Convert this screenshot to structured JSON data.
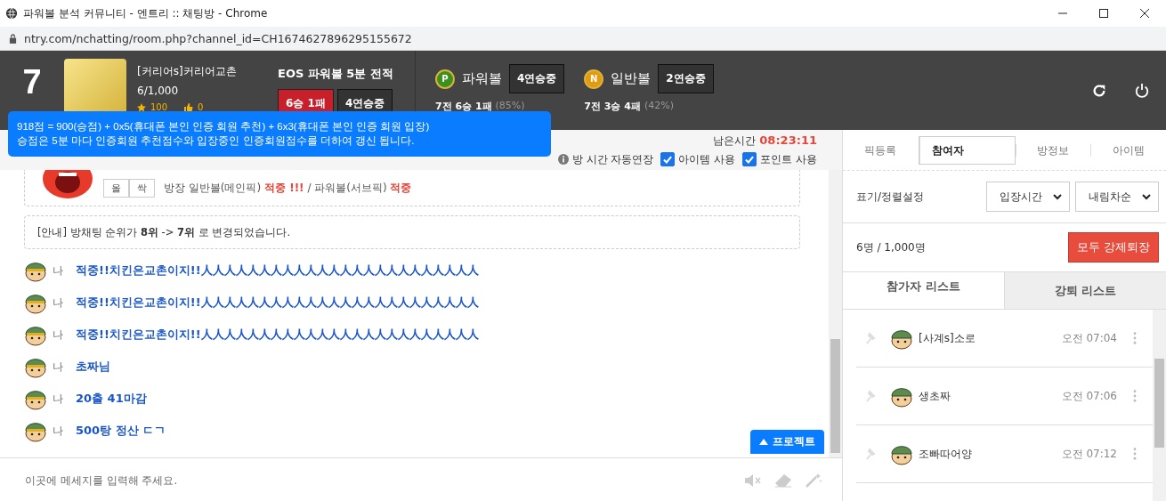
{
  "browser": {
    "title": "파워볼 분석 커뮤니티 - 엔트리 :: 채팅방 - Chrome",
    "url": "ntry.com/nchatting/room.php?channel_id=CH1674627896295155672"
  },
  "header": {
    "rank": "7",
    "room": {
      "name": "[커리어s]커리어교촌",
      "members": "6/1,000",
      "stars": "100",
      "likes": "0"
    },
    "eos": {
      "title": "EOS 파워볼 5분 전적",
      "record": "6승 1패",
      "streak": "4연승중"
    },
    "games": [
      {
        "kind": "powerball",
        "badge": "P",
        "name": "파워볼",
        "streak": "4연승중",
        "record": "7전 6승 1패",
        "rate": "(85%)"
      },
      {
        "kind": "normal",
        "badge": "N",
        "name": "일반볼",
        "streak": "2연승중",
        "record": "7전 3승 4패",
        "rate": "(42%)"
      }
    ]
  },
  "tooltip": {
    "lines": [
      "918점 = 900(승점) + 0x5(휴대폰 본인 인증 회원 추천) + 6x3(휴대폰 본인 인증 회원 입장)",
      "승점은 5분 마다 인증회원 추천점수와 입장중인 인증회원점수를 더하여 갱신 됩니다."
    ]
  },
  "room_bar": {
    "remaining_label": "남은시간",
    "remaining": "08:23:11",
    "options": [
      {
        "kind": "info",
        "label": "방 시간 자동연장"
      },
      {
        "kind": "checkbox",
        "label": "아이템 사용",
        "checked": true
      },
      {
        "kind": "checkbox",
        "label": "포인트 사용",
        "checked": true
      }
    ]
  },
  "chat": {
    "pick": {
      "buttons": [
        "올",
        "싹"
      ],
      "segments": [
        {
          "text": "방장 일반볼(메인픽) ",
          "hit": false
        },
        {
          "text": "적중 !!!",
          "hit": true
        },
        {
          "text": " / 파워볼(서브픽) ",
          "hit": false
        },
        {
          "text": "적중",
          "hit": true
        }
      ]
    },
    "notice": "[안내] 방채팅 순위가 **8위** -> **7위** 로 변경되었습니다.",
    "messages": [
      {
        "sender": "나",
        "text": "적중!!치킨은교촌이지!!人人人人人人人人人人人人人人人人人人人人人人人人"
      },
      {
        "sender": "나",
        "text": "적중!!치킨은교촌이지!!人人人人人人人人人人人人人人人人人人人人人人人人"
      },
      {
        "sender": "나",
        "text": "적중!!치킨은교촌이지!!人人人人人人人人人人人人人人人人人人人人人人人人"
      },
      {
        "sender": "나",
        "text": "초짜님"
      },
      {
        "sender": "나",
        "text": "20출 41마감"
      },
      {
        "sender": "나",
        "text": "500탕 정산 ㄷㄱ"
      }
    ],
    "project_button": "프로젝트",
    "input": {
      "placeholder": "이곳에 메세지를 입력해 주세요."
    }
  },
  "panel": {
    "tabs": [
      {
        "label": "픽등록",
        "selected": false
      },
      {
        "label": "참여자",
        "selected": true
      },
      {
        "label": "방정보",
        "selected": false
      },
      {
        "label": "아이템",
        "selected": false
      }
    ],
    "sort_label": "표기/정렬설정",
    "sort_field": "입장시간",
    "sort_order": "내림차순",
    "count": "6명 / 1,000명",
    "kick_all": "모두 강제퇴장",
    "list_tabs": [
      {
        "label": "참가자 리스트",
        "selected": true
      },
      {
        "label": "강퇴 리스트",
        "selected": false
      }
    ],
    "participants": [
      {
        "name": "[사계s]소로",
        "time": "오전 07:04"
      },
      {
        "name": "생초짜",
        "time": "오전 07:06"
      },
      {
        "name": "조빠따어양",
        "time": "오전 07:12"
      }
    ]
  }
}
